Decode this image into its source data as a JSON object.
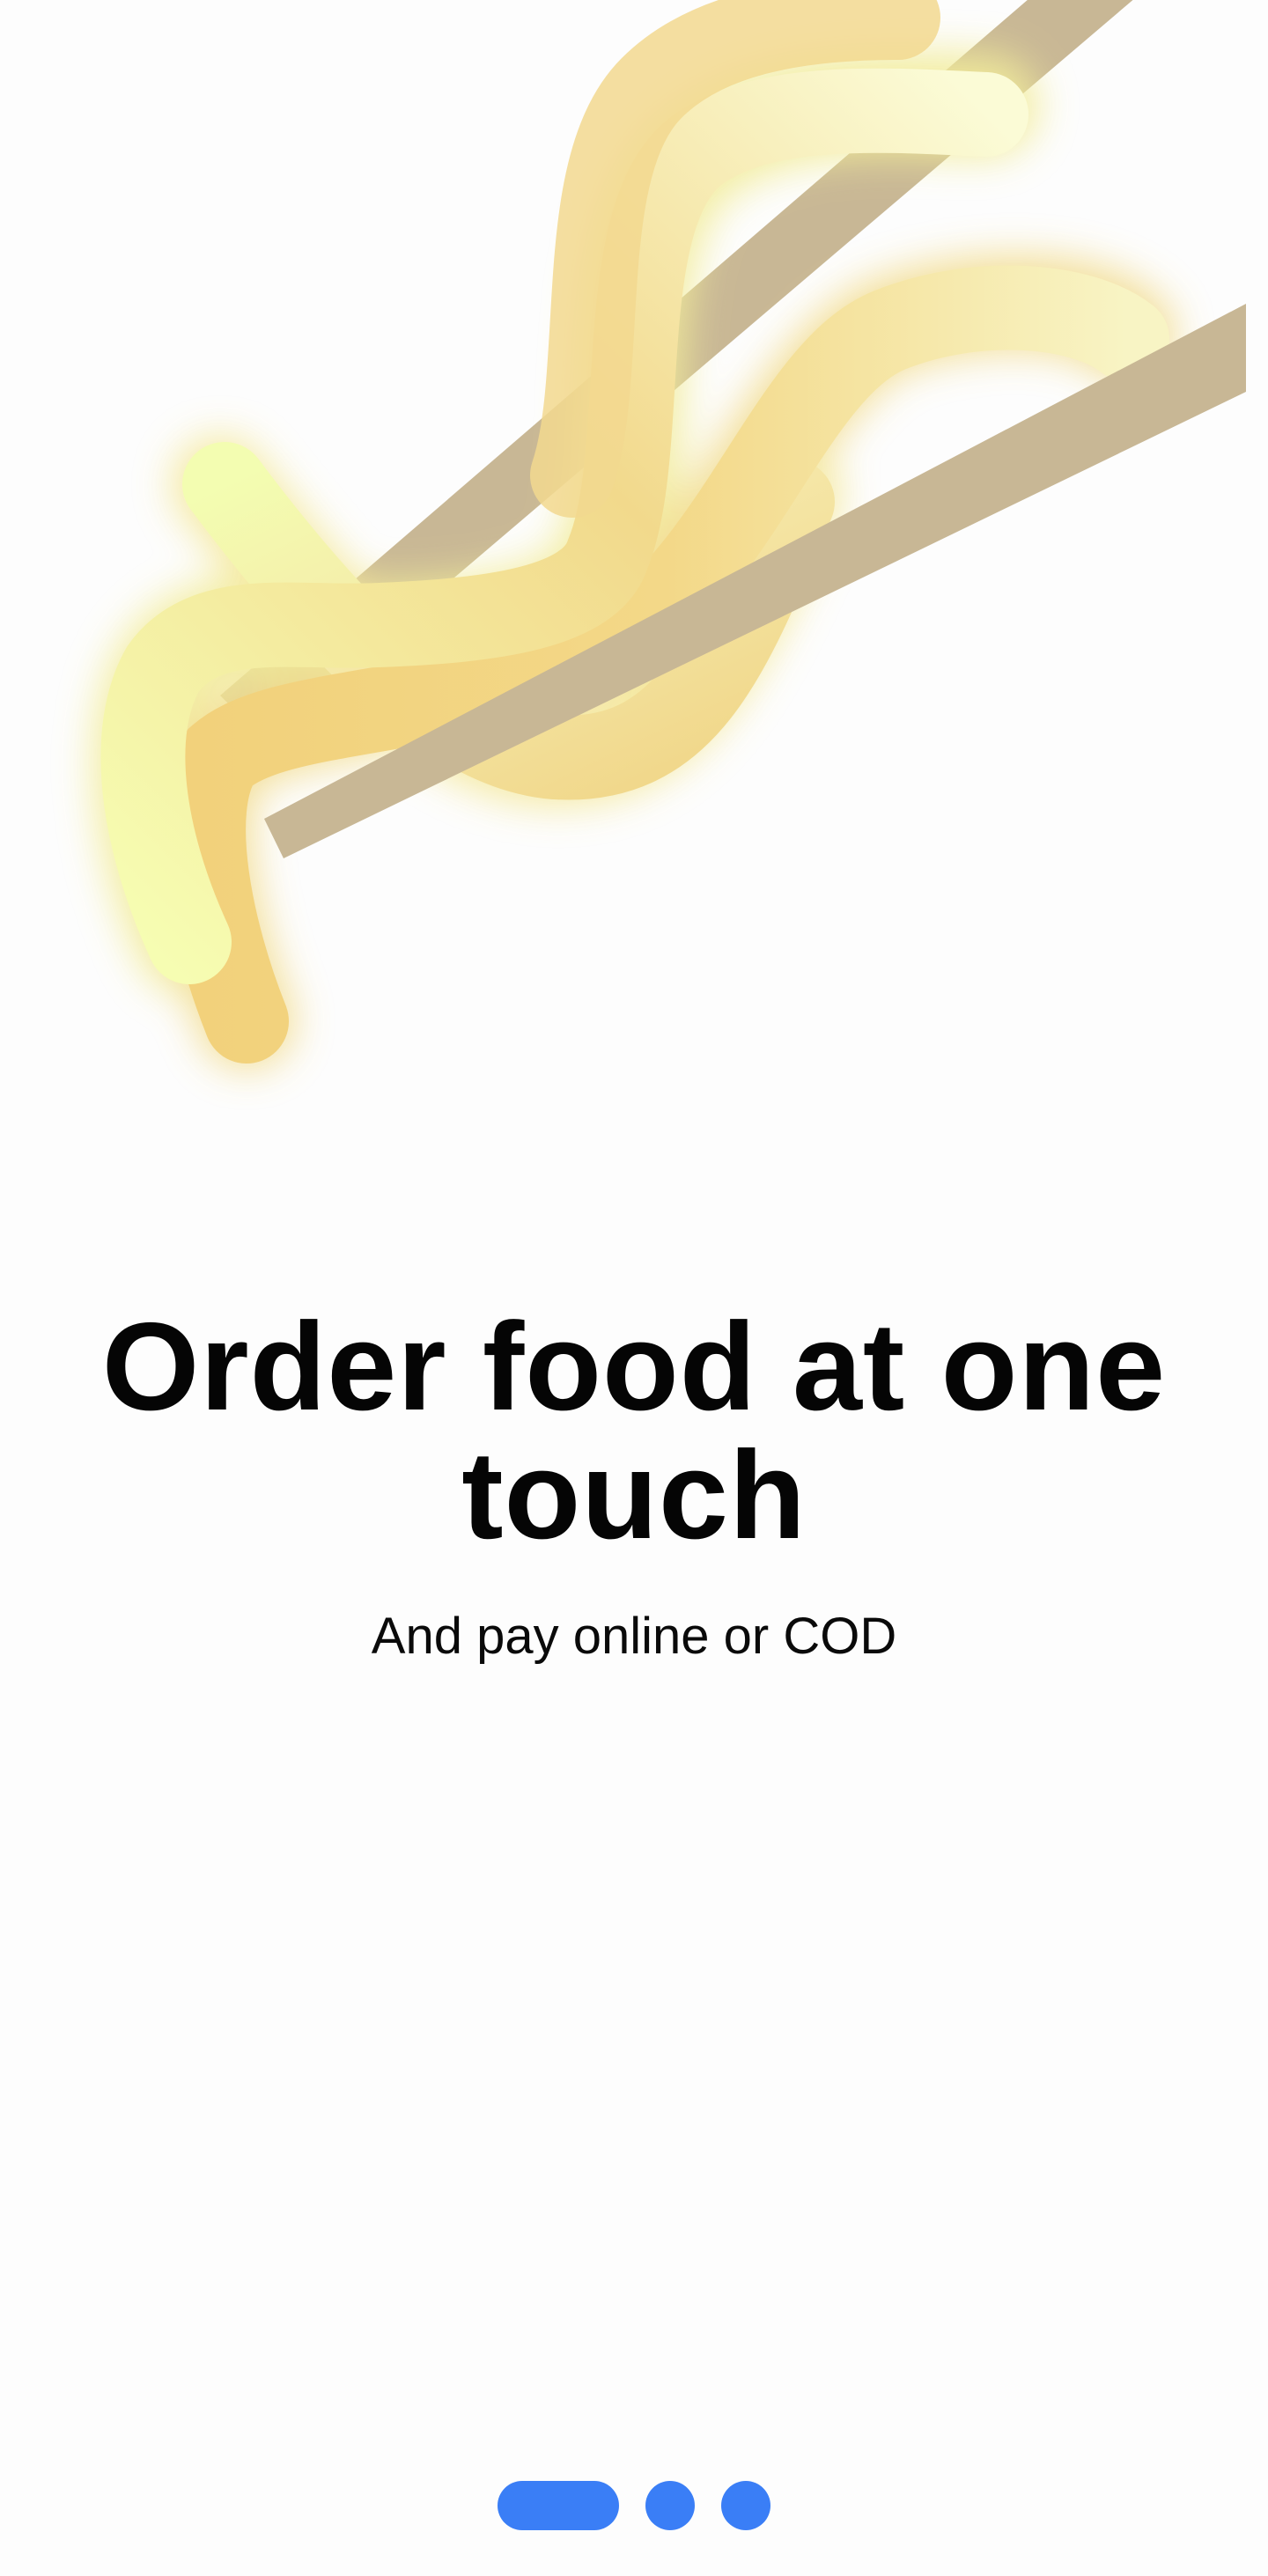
{
  "onboarding": {
    "illustration": "noodles-with-chopsticks-illustration",
    "headline": "Order food at one touch",
    "subtitle": "And pay online or COD"
  },
  "pager": {
    "total": 3,
    "current": 1
  },
  "colors": {
    "accent": "#3a7ef6",
    "background": "#fdfdfd",
    "chopsticks": "#c8b795",
    "noodle_light": "#f6fdb4",
    "noodle_mid": "#f7e8a2",
    "noodle_warm": "#f2d685"
  }
}
